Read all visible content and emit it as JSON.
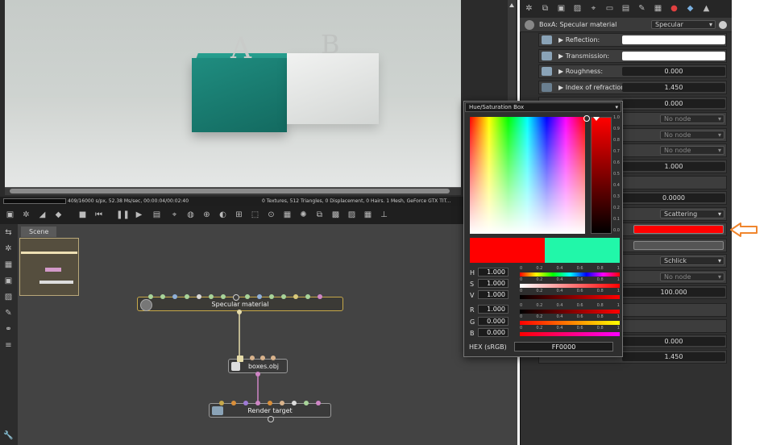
{
  "viewport": {
    "letters": [
      "A",
      "B"
    ],
    "status_text": "409/16000 s/px, 52.38 Ms/sec, 00:00:04/00:02:40",
    "status_right": "0 Textures, 512 Triangles, 0 Displacement, 0 Hairs. 1 Mesh, GeForce GTX TIT..."
  },
  "nodegraph": {
    "tab": "Scene",
    "nodes": {
      "specular": "Specular material",
      "mesh": "boxes.obj",
      "render": "Render target"
    }
  },
  "properties": {
    "header": "BoxA: Specular material",
    "type_dropdown": "Specular",
    "rows": [
      {
        "label": "Reflection:",
        "value": ""
      },
      {
        "label": "Transmission:",
        "value": ""
      },
      {
        "label": "Roughness:",
        "value": "0.000"
      },
      {
        "label": "Index of refraction:",
        "value": "1.450"
      }
    ],
    "partial_values": {
      "r1": "0.000",
      "node1": "No node",
      "node2": "No node",
      "node3": "No node",
      "r5": "1.000",
      "r7": "0.0000",
      "scattering": "Scattering",
      "schlick": "Schlick",
      "node4": "No node",
      "r12": "100.000",
      "r15": "0.000",
      "r16": "1.450"
    }
  },
  "picker": {
    "title": "Hue/Saturation Box",
    "value_scale": [
      "1.0",
      "0.9",
      "0.8",
      "0.7",
      "0.6",
      "0.5",
      "0.4",
      "0.3",
      "0.2",
      "0.1",
      "0.0"
    ],
    "slider_ticks": [
      "0",
      "0.2",
      "0.4",
      "0.6",
      "0.8",
      "1"
    ],
    "channels": [
      {
        "name": "H",
        "value": "1.000"
      },
      {
        "name": "S",
        "value": "1.000"
      },
      {
        "name": "V",
        "value": "1.000"
      },
      {
        "name": "R",
        "value": "1.000"
      },
      {
        "name": "G",
        "value": "0.000"
      },
      {
        "name": "B",
        "value": "0.000"
      }
    ],
    "hex_label": "HEX (sRGB)",
    "hex_value": "FF0000",
    "new_color": "#ff0000",
    "old_color": "#21f7a9"
  },
  "colors": {
    "accent_selected": "#c6a84a",
    "arrow": "#f0862e"
  }
}
